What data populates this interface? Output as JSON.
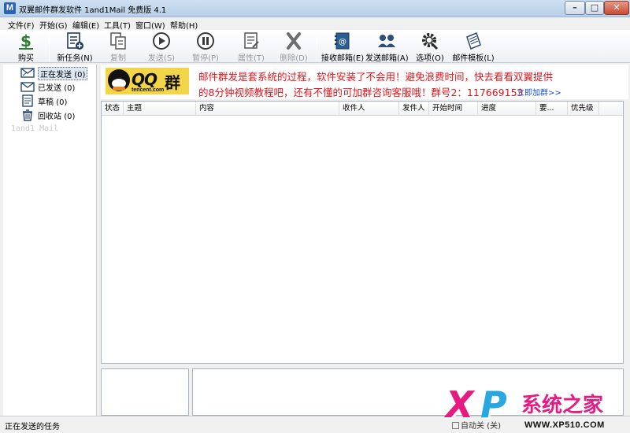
{
  "window": {
    "title": "双翼邮件群发软件 1and1Mail 免费版 4.1",
    "icon_letter": "M",
    "buttons": {
      "minimize": "–",
      "maximize": "□",
      "close": "✕"
    }
  },
  "menu": [
    "文件(F)",
    "开始(G)",
    "编辑(E)",
    "工具(T)",
    "窗口(W)",
    "帮助(H)"
  ],
  "toolbar": {
    "buy": "购买",
    "new_task": "新任务",
    "new_task_key": "(N)",
    "copy": "复制",
    "send": "发送",
    "send_key": "(S)",
    "pause": "暂停",
    "pause_key": "(P)",
    "properties": "属性",
    "properties_key": "(T)",
    "delete": "删除",
    "delete_key": "(D)",
    "inbox": "接收邮箱",
    "inbox_key": "(E)",
    "sender": "发送邮箱",
    "sender_key": "(A)",
    "options": "选项",
    "options_key": "(O)",
    "template": "邮件模板",
    "template_key": "(L)"
  },
  "folders": [
    {
      "label": "正在发送",
      "count": "(0)",
      "icon": "sending-envelope-icon"
    },
    {
      "label": "已发送",
      "count": "(0)",
      "icon": "envelope-icon"
    },
    {
      "label": "草稿",
      "count": "(0)",
      "icon": "draft-icon"
    },
    {
      "label": "回收站",
      "count": "(0)",
      "icon": "trash-icon"
    }
  ],
  "sidebar_watermark": "1and1 Mail",
  "banner": {
    "logo_word": "QQ",
    "logo_qun": "群",
    "logo_site": "tencent.com",
    "line1": "邮件群发是套系统的过程，软件安装了不会用！避免浪费时间，快去看看双翼提供",
    "line2": "的8分钟视频教程吧，还有不懂的可加群咨询客服哦！群号2：117669153",
    "link": "立即加群>>"
  },
  "table": {
    "columns": [
      "状态",
      "主题",
      "内容",
      "收件人",
      "发件人",
      "开始时间",
      "进度",
      "要...",
      "优先级"
    ]
  },
  "status": {
    "text": "正在发送的任务",
    "auto_close": "自动关",
    "auto_close_suffix": "关"
  },
  "watermark": {
    "x": "X",
    "p": "P",
    "cn": "系统之家",
    "url": "WWW.XP510.COM"
  },
  "colors": {
    "banner_text": "#e0161c",
    "link": "#1b4fd6",
    "watermark_pink": "#e51b82",
    "watermark_blue": "#28a7e1"
  }
}
